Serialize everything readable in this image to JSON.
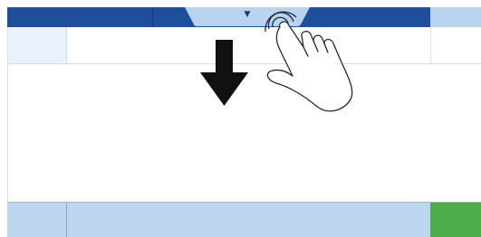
{
  "header": {
    "pull_tab_glyph": "▼",
    "pull_tab_icon": "caret-down-icon"
  },
  "gesture": {
    "arrow_icon": "down-arrow-icon",
    "hand_icon": "tap-hand-icon",
    "touch_ripple_icon": "touch-ripple-icon",
    "direction": "down"
  },
  "colors": {
    "header_blue": "#1f4e9a",
    "tab_light_blue": "#b9d2ee",
    "footer_light_blue": "#bcd6f0",
    "ok_green": "#4cae48",
    "arrow_black": "#111111"
  }
}
